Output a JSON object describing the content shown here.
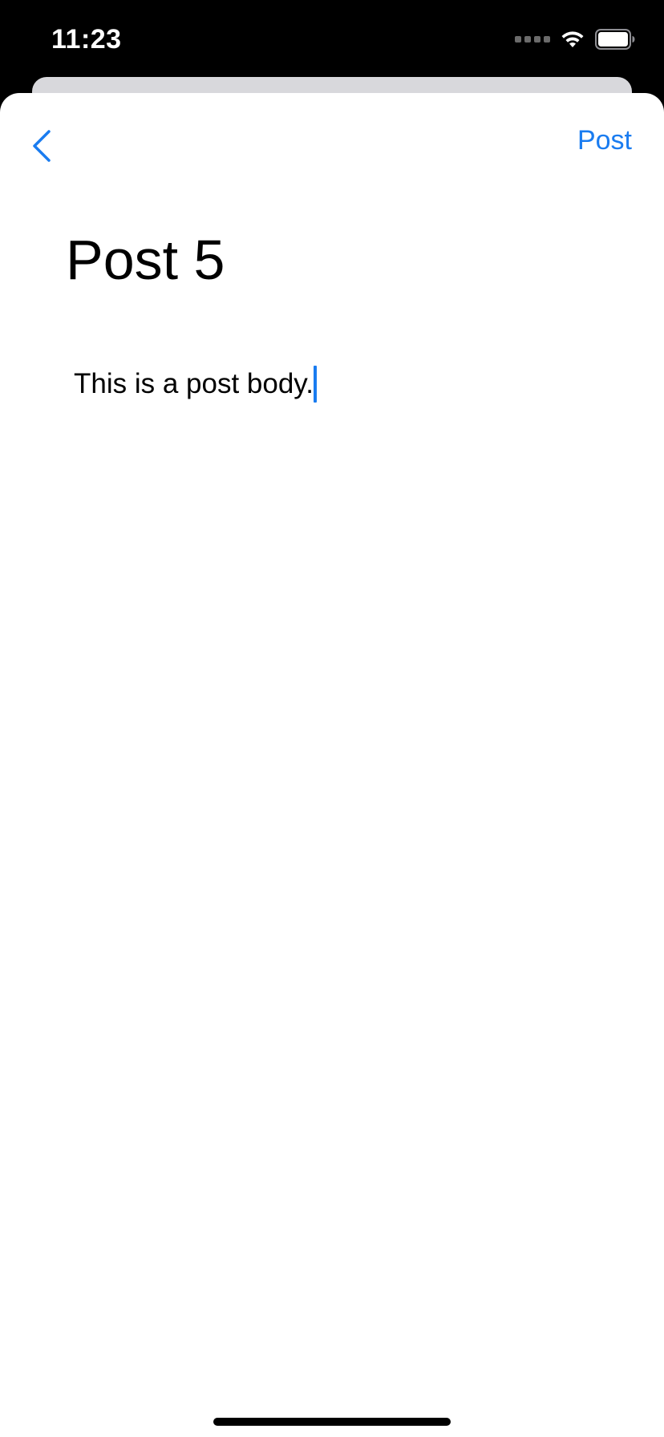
{
  "status_bar": {
    "time": "11:23",
    "icons": [
      "signal-icon",
      "wifi-icon",
      "battery-icon"
    ]
  },
  "nav": {
    "back_icon": "chevron-left-icon",
    "post_label": "Post"
  },
  "editor": {
    "title": "Post 5",
    "body": "This is a post body."
  },
  "colors": {
    "accent": "#1a7cf0",
    "background": "#ffffff",
    "status_bar_bg": "#000000"
  }
}
